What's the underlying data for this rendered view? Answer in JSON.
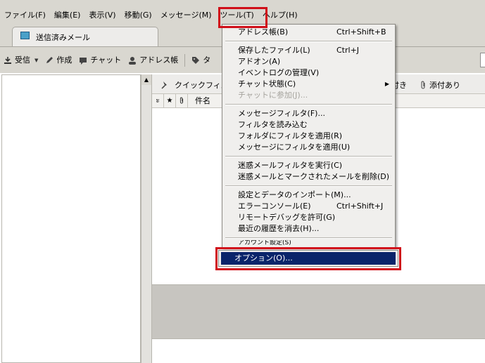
{
  "menubar": {
    "items": [
      {
        "label": "ファイル(F)"
      },
      {
        "label": "編集(E)"
      },
      {
        "label": "表示(V)"
      },
      {
        "label": "移動(G)"
      },
      {
        "label": "メッセージ(M)"
      },
      {
        "label": "ツール(T)"
      },
      {
        "label": "ヘルプ(H)"
      }
    ]
  },
  "tab": {
    "label": "送信済みメール",
    "icon": "folder-sent-icon"
  },
  "toolbar": {
    "receive": "受信",
    "compose": "作成",
    "chat": "チャット",
    "addressbook": "アドレス帳",
    "tag": "タ"
  },
  "quickfilter": {
    "label": "クイックフィルタ",
    "right_partial": "付き",
    "attachment": "添付あり"
  },
  "columns": {
    "subject": "件名"
  },
  "tools_menu": {
    "items": [
      {
        "label": "アドレス帳(B)",
        "shortcut": "Ctrl+Shift+B"
      },
      {
        "label": "保存したファイル(L)",
        "shortcut": "Ctrl+J"
      },
      {
        "label": "アドオン(A)",
        "shortcut": ""
      },
      {
        "label": "イベントログの管理(V)",
        "shortcut": ""
      },
      {
        "label": "チャット状態(C)",
        "shortcut": ""
      },
      {
        "label": "チャットに参加(J)...",
        "shortcut": ""
      },
      {
        "label": "メッセージフィルタ(F)...",
        "shortcut": ""
      },
      {
        "label": "フィルタを読み込む",
        "shortcut": ""
      },
      {
        "label": "フォルダにフィルタを適用(R)",
        "shortcut": ""
      },
      {
        "label": "メッセージにフィルタを適用(U)",
        "shortcut": ""
      },
      {
        "label": "迷惑メールフィルタを実行(C)",
        "shortcut": ""
      },
      {
        "label": "迷惑メールとマークされたメールを削除(D)",
        "shortcut": ""
      },
      {
        "label": "設定とデータのインポート(M)...",
        "shortcut": ""
      },
      {
        "label": "エラーコンソール(E)",
        "shortcut": "Ctrl+Shift+J"
      },
      {
        "label": "リモートデバッグを許可(G)",
        "shortcut": ""
      },
      {
        "label": "最近の履歴を消去(H)...",
        "shortcut": ""
      },
      {
        "label": "アカウント設定(S)",
        "shortcut": ""
      },
      {
        "label": "オプション(O)...",
        "shortcut": ""
      }
    ]
  },
  "colors": {
    "highlight_box": "#d0101a",
    "menu_selection": "#0a246a"
  }
}
